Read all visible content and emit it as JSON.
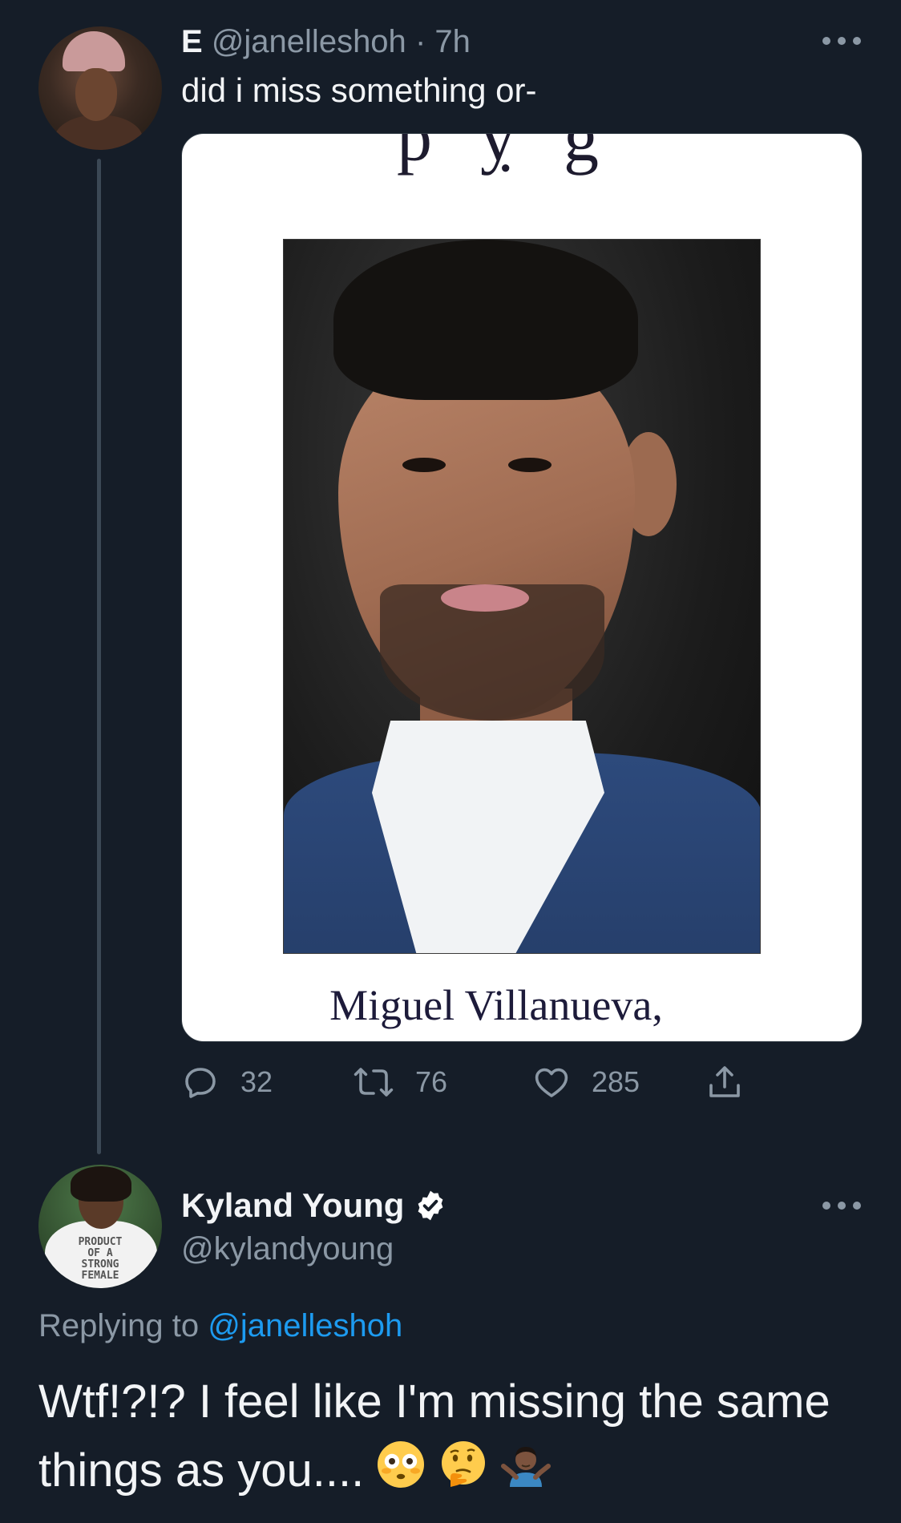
{
  "tweet": {
    "display_name": "E",
    "handle": "@janelleshoh",
    "separator": "·",
    "time": "7h",
    "text": "did i miss something or-",
    "media": {
      "caption_name": "Miguel Villanueva,"
    },
    "actions": {
      "replies": "32",
      "retweets": "76",
      "likes": "285"
    }
  },
  "reply": {
    "display_name": "Kyland Young",
    "handle": "@kylandyoung",
    "avatar_shirt_text": "PRODUCT\nOF A\nSTRONG\nFEMALE",
    "replying_prefix": "Replying to",
    "replying_to": "@janelleshoh",
    "text": "Wtf!?!? I feel like I'm missing the same things as you...."
  },
  "colors": {
    "background": "#151d28",
    "secondary_text": "#8b98a5",
    "link": "#1d9bf0",
    "verified": "#ffffff"
  },
  "icons": [
    "reply-icon",
    "retweet-icon",
    "like-icon",
    "share-icon",
    "more-icon",
    "verified-badge-icon",
    "flushed-face-emoji",
    "thinking-face-emoji",
    "shrugging-person-emoji"
  ]
}
